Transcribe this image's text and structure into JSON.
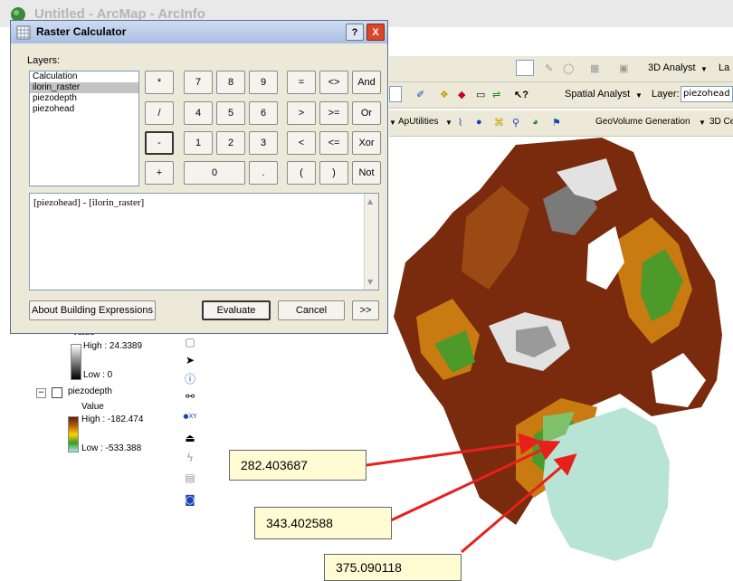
{
  "app": {
    "title": "Untitled - ArcMap - ArcInfo"
  },
  "toolbar": {
    "analyst3d_label": "3D Analyst",
    "analyst3d_trunc": "La",
    "spatial_analyst_label": "Spatial Analyst",
    "layer_label": "Layer:",
    "layer_value": "piezohead",
    "aputilities_label": "ApUtilities",
    "geovolume_label": "GeoVolume Generation",
    "cell_trunc": "3D Ce"
  },
  "dialog": {
    "title": "Raster Calculator",
    "help_icon": "?",
    "close_icon": "X",
    "layers_label": "Layers:",
    "layers": [
      "Calculation",
      "ilorin_raster",
      "piezodepth",
      "piezohead"
    ],
    "selected_layer_index": 1,
    "keypad": [
      [
        "*",
        "7",
        "8",
        "9",
        "=",
        "<>",
        "And"
      ],
      [
        "/",
        "4",
        "5",
        "6",
        ">",
        ">=",
        "Or"
      ],
      [
        "-",
        "1",
        "2",
        "3",
        "<",
        "<=",
        "Xor"
      ],
      [
        "+",
        "0",
        ".",
        "(",
        ")",
        "Not"
      ]
    ],
    "expression": "[piezohead] - [ilorin_raster]",
    "about_button": "About Building Expressions",
    "evaluate_button": "Evaluate",
    "cancel_button": "Cancel",
    "more_button": ">>"
  },
  "toc": {
    "value_label": "Value",
    "raster_high": "High : 24.3389",
    "raster_low": "Low : 0",
    "piezodepth_name": "piezodepth",
    "piezodepth_value_label": "Value",
    "piezodepth_high": "High : -182.474",
    "piezodepth_low": "Low : -533.388"
  },
  "callouts": [
    "282.403687",
    "343.402588",
    "375.090118"
  ],
  "colors": {
    "arrow": "#e8201c",
    "callout_bg": "#fffbd2",
    "dialog_bg": "#ece9d8"
  }
}
